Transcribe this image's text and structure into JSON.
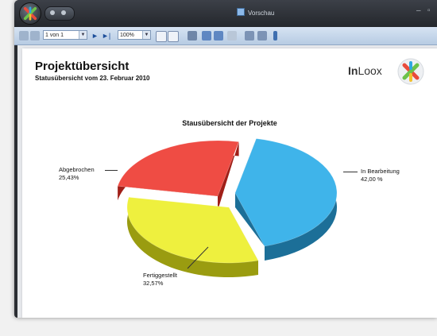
{
  "window": {
    "title": "Vorschau"
  },
  "toolbar": {
    "page_select": "1 von 1",
    "zoom_select": "100%"
  },
  "report": {
    "title": "Projektübersicht",
    "subtitle": "Statusübersicht vom 23. Februar 2010",
    "logo_text_bold": "In",
    "logo_text_rest": "Loox"
  },
  "chart_data": {
    "type": "pie",
    "title": "Stausübersicht der Projekte",
    "slices": [
      {
        "label": "In Bearbeitung",
        "value_text": "42,00 %",
        "value": 42.0,
        "color": "#3fb4ea",
        "side_color": "#1c6f98"
      },
      {
        "label": "Fertiggestellt",
        "value_text": "32,57%",
        "value": 32.57,
        "color": "#eef03e",
        "side_color": "#9a9c10"
      },
      {
        "label": "Abgebrochen",
        "value_text": "25,43%",
        "value": 25.43,
        "color": "#ef4c44",
        "side_color": "#a01f18"
      }
    ]
  },
  "colors": {
    "accent_blue": "#3fb4ea",
    "accent_yellow": "#eef03e",
    "accent_red": "#ef4c44"
  }
}
